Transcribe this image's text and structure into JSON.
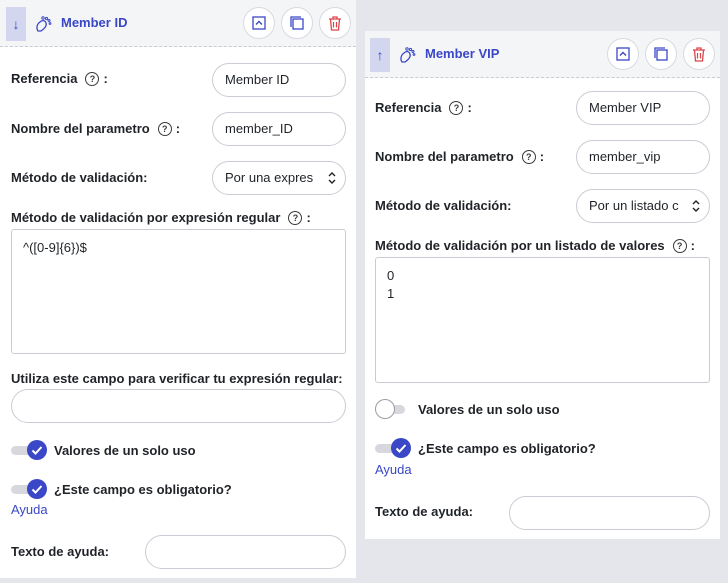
{
  "colors": {
    "accent": "#3a47c6",
    "delete": "#d9454a",
    "header_bg": "#f4f5f7"
  },
  "icons": [
    "arrow-down-icon",
    "arrow-up-icon",
    "footprint-icon",
    "collapse-icon",
    "duplicate-icon",
    "trash-icon",
    "help-icon",
    "check-icon",
    "select-arrows-icon"
  ],
  "left_card": {
    "drag_arrow": "↓",
    "title": "Member ID",
    "referencia_label": "Referencia",
    "referencia_colon": ":",
    "referencia_value": "Member ID",
    "nombre_label": "Nombre del parametro",
    "nombre_colon": ":",
    "nombre_value": "member_ID",
    "metodo_label": "Método de validación:",
    "metodo_value": "Por una expres",
    "regex_label": "Método de validación por expresión regular",
    "regex_colon": ":",
    "regex_value": "^([0-9]{6})$",
    "verify_label": "Utiliza este campo para verificar tu expresión regular:",
    "verify_value": "",
    "single_use_label": "Valores de un solo uso",
    "single_use_on": true,
    "required_label": "¿Este campo es obligatorio?",
    "required_on": true,
    "help_link": "Ayuda",
    "help_text_label": "Texto de ayuda:",
    "help_text_value": ""
  },
  "right_card": {
    "drag_arrow": "↑",
    "title": "Member VIP",
    "referencia_label": "Referencia",
    "referencia_colon": ":",
    "referencia_value": "Member VIP",
    "nombre_label": "Nombre del parametro",
    "nombre_colon": ":",
    "nombre_value": "member_vip",
    "metodo_label": "Método de validación:",
    "metodo_value": "Por un listado c",
    "list_label": "Método de validación por un listado de valores",
    "list_colon": ":",
    "list_value": "0\n1",
    "single_use_label": "Valores de un solo uso",
    "single_use_on": false,
    "required_label": "¿Este campo es obligatorio?",
    "required_on": true,
    "help_link": "Ayuda",
    "help_text_label": "Texto de ayuda:",
    "help_text_value": ""
  }
}
